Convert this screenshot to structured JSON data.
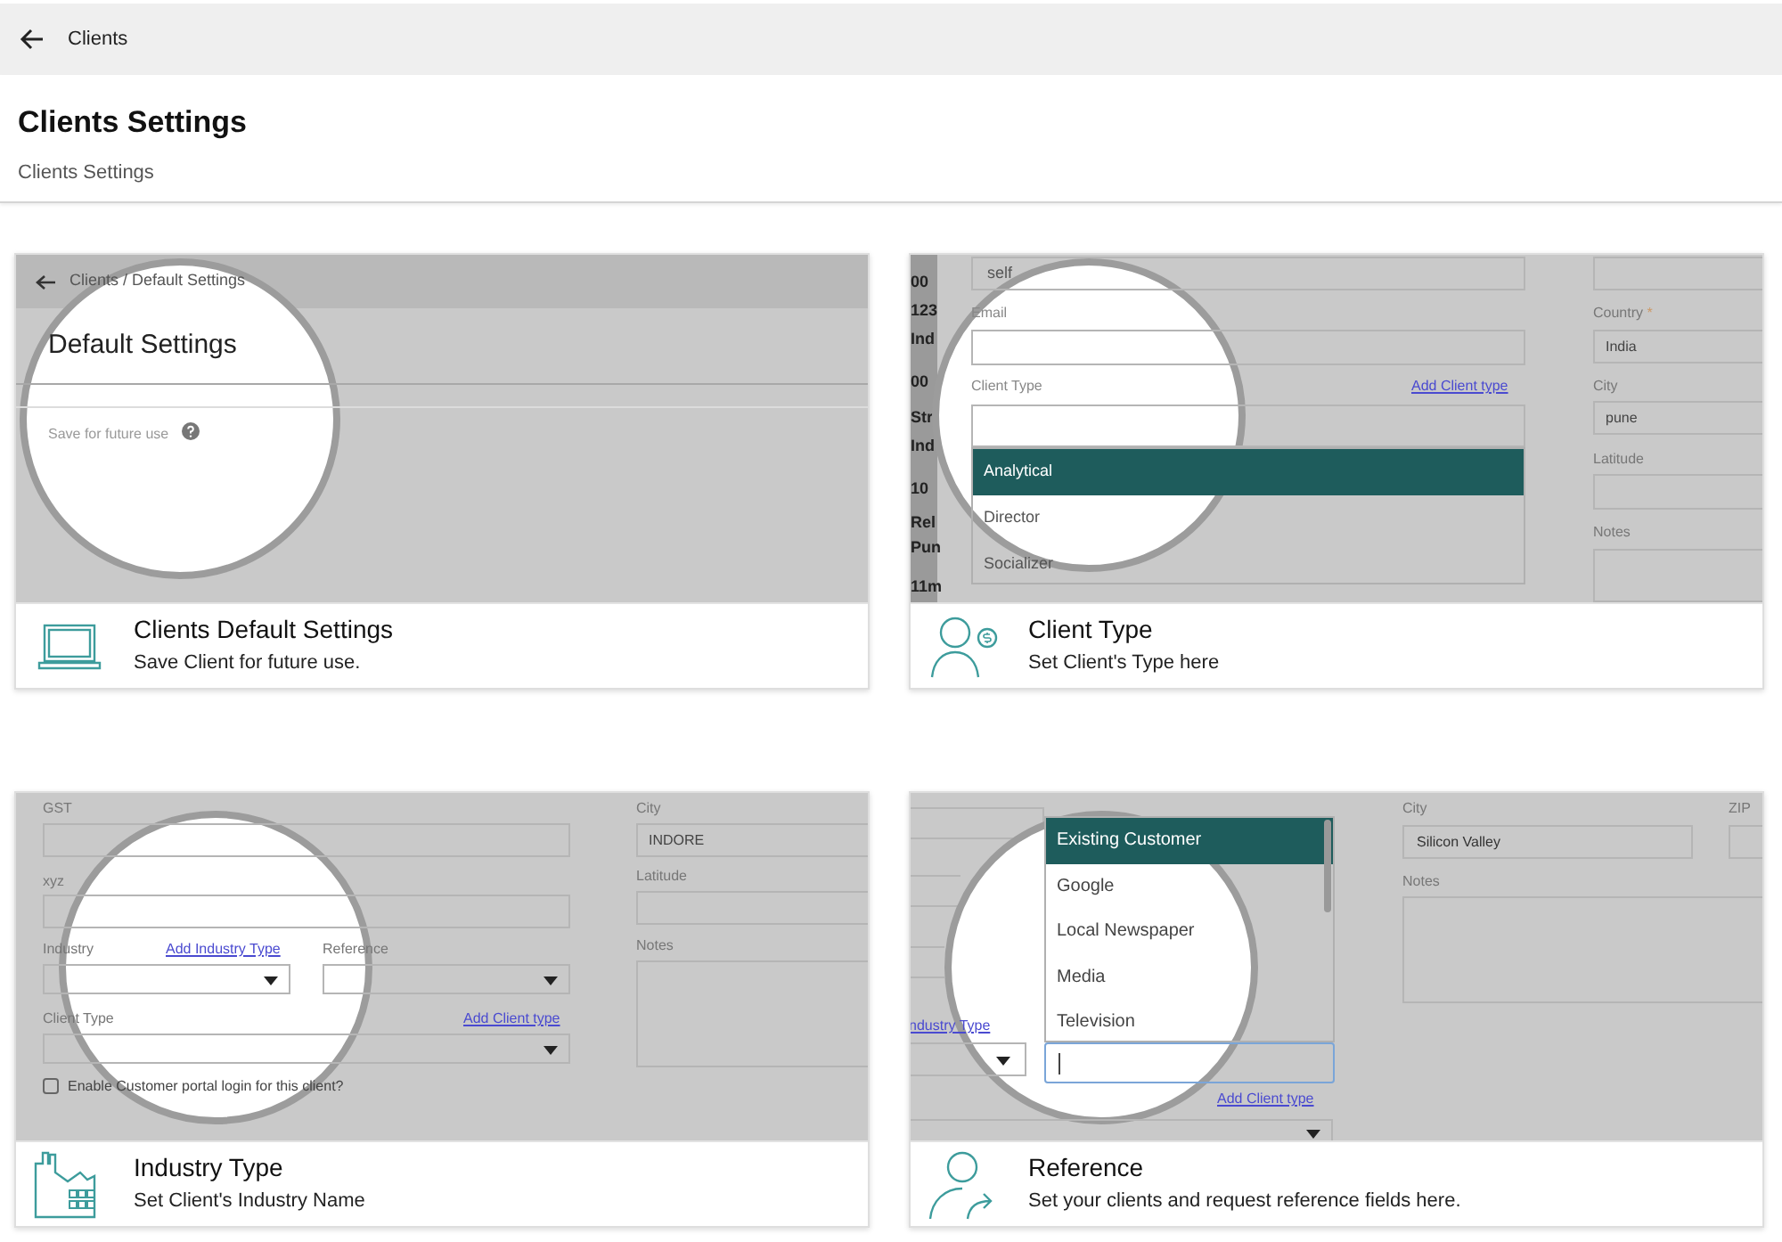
{
  "topbar": {
    "title": "Clients"
  },
  "header": {
    "title": "Clients Settings",
    "subtitle": "Clients Settings"
  },
  "cards": [
    {
      "kind": "default_settings",
      "title": "Clients Default Settings",
      "description": "Save Client for future use.",
      "preview": {
        "breadcrumb": "Clients / Default Settings",
        "heading": "Default Settings",
        "field_label": "Save for future use"
      }
    },
    {
      "kind": "client_type",
      "title": "Client Type",
      "description": "Set Client's Type here",
      "preview": {
        "side_fragments": [
          "00",
          "123",
          "Ind",
          "00",
          "Str",
          "Ind",
          "10",
          "Rel",
          "Pun",
          "11m"
        ],
        "name_value": "self",
        "email_label": "Email",
        "client_type_label": "Client Type",
        "add_link": "Add Client type",
        "options": [
          {
            "label": "Analytical",
            "selected": true
          },
          {
            "label": "Director",
            "selected": false
          },
          {
            "label": "Socializer",
            "selected": false
          }
        ],
        "country_label": "Country",
        "required_mark": "*",
        "country_value": "India",
        "city_label": "City",
        "city_value": "pune",
        "latitude_label": "Latitude",
        "notes_label": "Notes"
      }
    },
    {
      "kind": "industry",
      "title": "Industry Type",
      "description": "Set Client's Industry Name",
      "preview": {
        "gst_label": "GST",
        "xyz_label": "xyz",
        "industry_label": "Industry",
        "add_industry_link": "Add Industry Type",
        "reference_label": "Reference",
        "client_type_label": "Client Type",
        "add_client_link": "Add Client type",
        "portal_checkbox": {
          "label": "Enable Customer portal login for this client?",
          "checked": false
        },
        "city_label": "City",
        "city_value": "INDORE",
        "latitude_label": "Latitude",
        "notes_label": "Notes"
      }
    },
    {
      "kind": "reference",
      "title": "Reference",
      "description": "Set your clients and request reference fields here.",
      "preview": {
        "options": [
          {
            "label": "Existing Customer",
            "selected": true
          },
          {
            "label": "Google",
            "selected": false
          },
          {
            "label": "Local Newspaper",
            "selected": false
          },
          {
            "label": "Media",
            "selected": false
          },
          {
            "label": "Television",
            "selected": false
          }
        ],
        "industry_link": "ndustry Type",
        "add_client_link": "Add Client type",
        "city_label": "City",
        "city_value": "Silicon Valley",
        "zip_label": "ZIP",
        "notes_label": "Notes"
      }
    }
  ]
}
